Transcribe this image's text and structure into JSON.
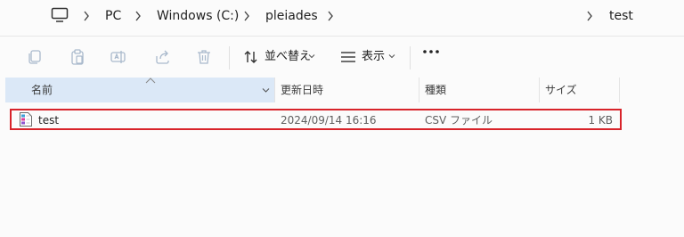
{
  "address_bar": {
    "crumbs": [
      "PC",
      "Windows (C:)",
      "pleiades",
      "test"
    ]
  },
  "toolbar": {
    "sort_label": "並べ替え",
    "view_label": "表示"
  },
  "columns": [
    "名前",
    "更新日時",
    "種類",
    "サイズ"
  ],
  "files": [
    {
      "name": "test",
      "modified": "2024/09/14 16:16",
      "type": "CSV ファイル",
      "size": "1 KB"
    }
  ],
  "colors": {
    "highlight_border": "#d8232a",
    "header_selected": "#dbe8f7"
  }
}
